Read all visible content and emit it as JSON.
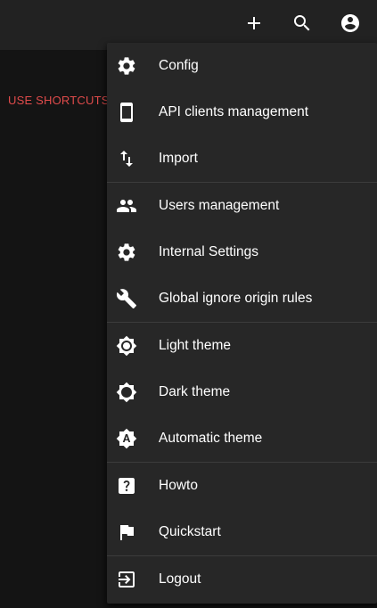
{
  "topbar": {
    "actions": [
      {
        "icon": "plus-icon"
      },
      {
        "icon": "search-icon"
      },
      {
        "icon": "account-circle-icon"
      }
    ]
  },
  "main": {
    "shortcuts_label": "USE SHORTCUTS",
    "shortcuts_color": "#e04b4b"
  },
  "menu": {
    "groups": [
      [
        {
          "label": "Config",
          "icon": "gear-icon"
        },
        {
          "label": "API clients management",
          "icon": "smartphone-icon"
        },
        {
          "label": "Import",
          "icon": "swap-vertical-icon"
        }
      ],
      [
        {
          "label": "Users management",
          "icon": "people-icon"
        },
        {
          "label": "Internal Settings",
          "icon": "gear-icon"
        },
        {
          "label": "Global ignore origin rules",
          "icon": "wrench-icon"
        }
      ],
      [
        {
          "label": "Light theme",
          "icon": "brightness-light-icon"
        },
        {
          "label": "Dark theme",
          "icon": "brightness-dark-icon"
        },
        {
          "label": "Automatic theme",
          "icon": "brightness-auto-icon"
        }
      ],
      [
        {
          "label": "Howto",
          "icon": "help-box-icon"
        },
        {
          "label": "Quickstart",
          "icon": "flag-icon"
        }
      ],
      [
        {
          "label": "Logout",
          "icon": "exit-to-app-icon"
        }
      ]
    ]
  }
}
